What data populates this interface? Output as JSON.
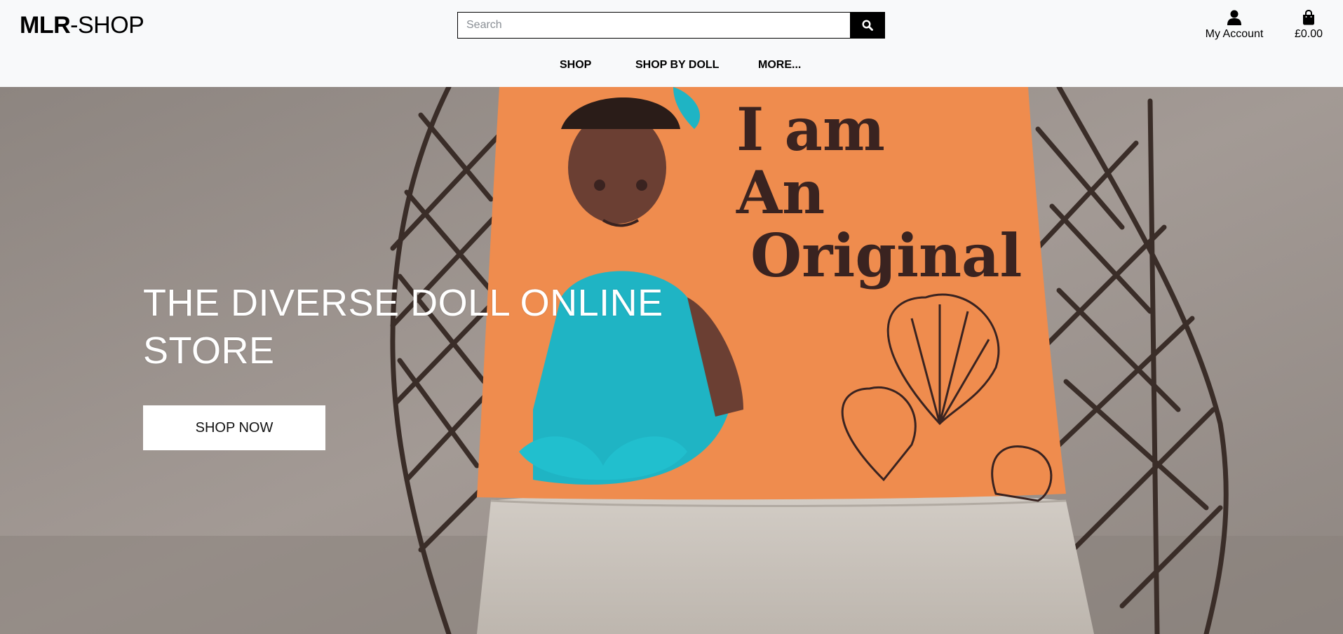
{
  "header": {
    "logo_bold": "MLR",
    "logo_rest": "-SHOP",
    "search_placeholder": "Search",
    "account_label": "My Account",
    "bag_total": "£0.00"
  },
  "nav": {
    "items": [
      {
        "label": "SHOP"
      },
      {
        "label": "SHOP BY DOLL"
      },
      {
        "label": "MORE..."
      }
    ]
  },
  "hero": {
    "title": "THE DIVERSE DOLL ONLINE STORE",
    "cta_label": "SHOP NOW",
    "pillow_text_1": "I am",
    "pillow_text_2": "An",
    "pillow_text_3": "Original"
  },
  "colors": {
    "header_bg": "#f8f9fa",
    "pillow_orange": "#ef8c4e",
    "dress_teal": "#1fb4c4",
    "wall_gray": "#9a918c"
  },
  "icons": {
    "search": "search-icon",
    "account": "user-icon",
    "bag": "shopping-bag-icon"
  }
}
